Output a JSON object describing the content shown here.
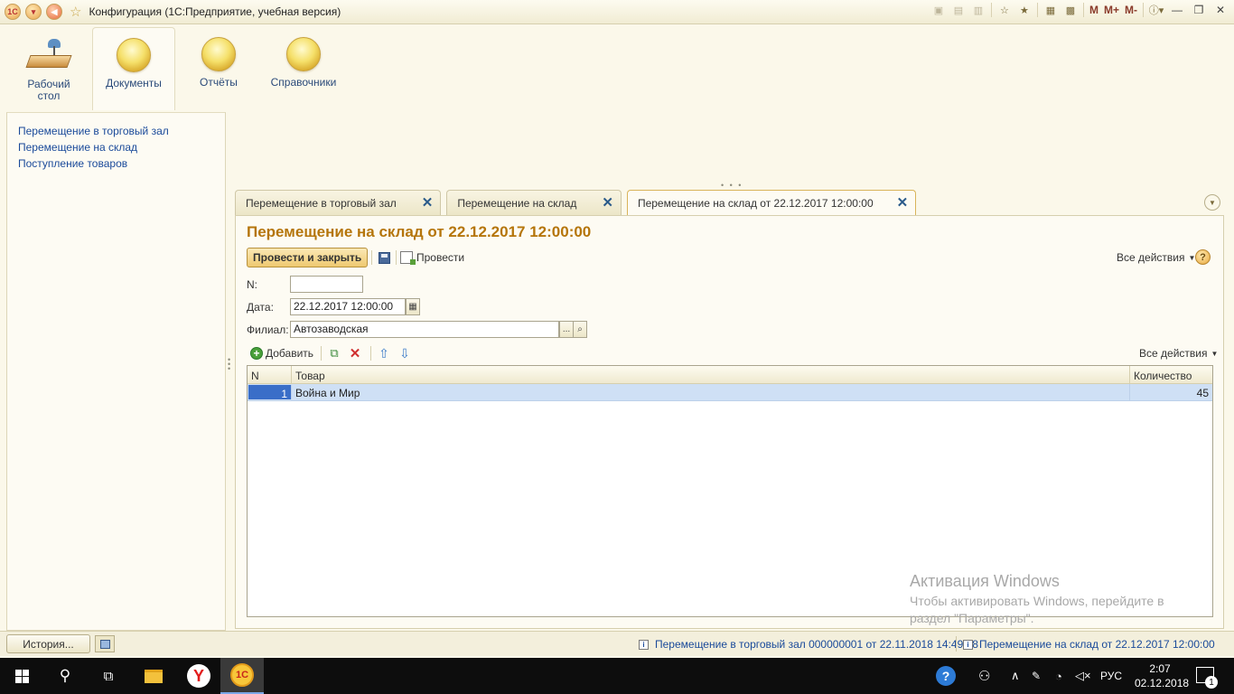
{
  "titlebar": {
    "app_title": "Конфигурация  (1С:Предприятие, учебная версия)",
    "logo_text": "1С",
    "m_label": "M",
    "m_plus_label": "M+",
    "m_minus_label": "M-"
  },
  "sections": [
    {
      "label": "Рабочий стол",
      "icon": "desktop-icon"
    },
    {
      "label": "Документы",
      "icon": "section-ball-icon"
    },
    {
      "label": "Отчёты",
      "icon": "section-ball-icon"
    },
    {
      "label": "Справочники",
      "icon": "section-ball-icon"
    }
  ],
  "nav": {
    "items": [
      "Перемещение в торговый зал",
      "Перемещение на склад",
      "Поступление товаров"
    ]
  },
  "tabs": [
    {
      "label": "Перемещение в торговый зал"
    },
    {
      "label": "Перемещение на склад"
    },
    {
      "label": "Перемещение на склад  от 22.12.2017 12:00:00"
    }
  ],
  "form": {
    "title": "Перемещение на склад  от 22.12.2017 12:00:00",
    "post_close_label": "Провести и закрыть",
    "post_label": "Провести",
    "all_actions": "Все действия",
    "help": "?",
    "number_label": "N:",
    "number_value": "",
    "date_label": "Дата:",
    "date_value": "22.12.2017 12:00:00",
    "branch_label": "Филиал:",
    "branch_value": "Автозаводская",
    "ellipsis": "...",
    "table_toolbar": {
      "add_label": "Добавить",
      "all_actions": "Все действия"
    },
    "table": {
      "columns": [
        "N",
        "Товар",
        "Количество"
      ],
      "rows": [
        {
          "n": "1",
          "item": "Война и Мир",
          "qty": "45"
        }
      ]
    }
  },
  "watermark": {
    "title": "Активация Windows",
    "line1": "Чтобы активировать Windows, перейдите в",
    "line2": "раздел \"Параметры\"."
  },
  "statusbar": {
    "history_label": "История...",
    "link1": "Перемещение в торговый зал 000000001 от 22.11.2018 14:49:18",
    "link2": "Перемещение на склад  от 22.12.2017 12:00:00"
  },
  "taskbar": {
    "lang": "РУС",
    "time": "2:07",
    "date": "02.12.2018",
    "notifications": "1",
    "yandex_letter": "Y",
    "onec_text": "1С"
  }
}
